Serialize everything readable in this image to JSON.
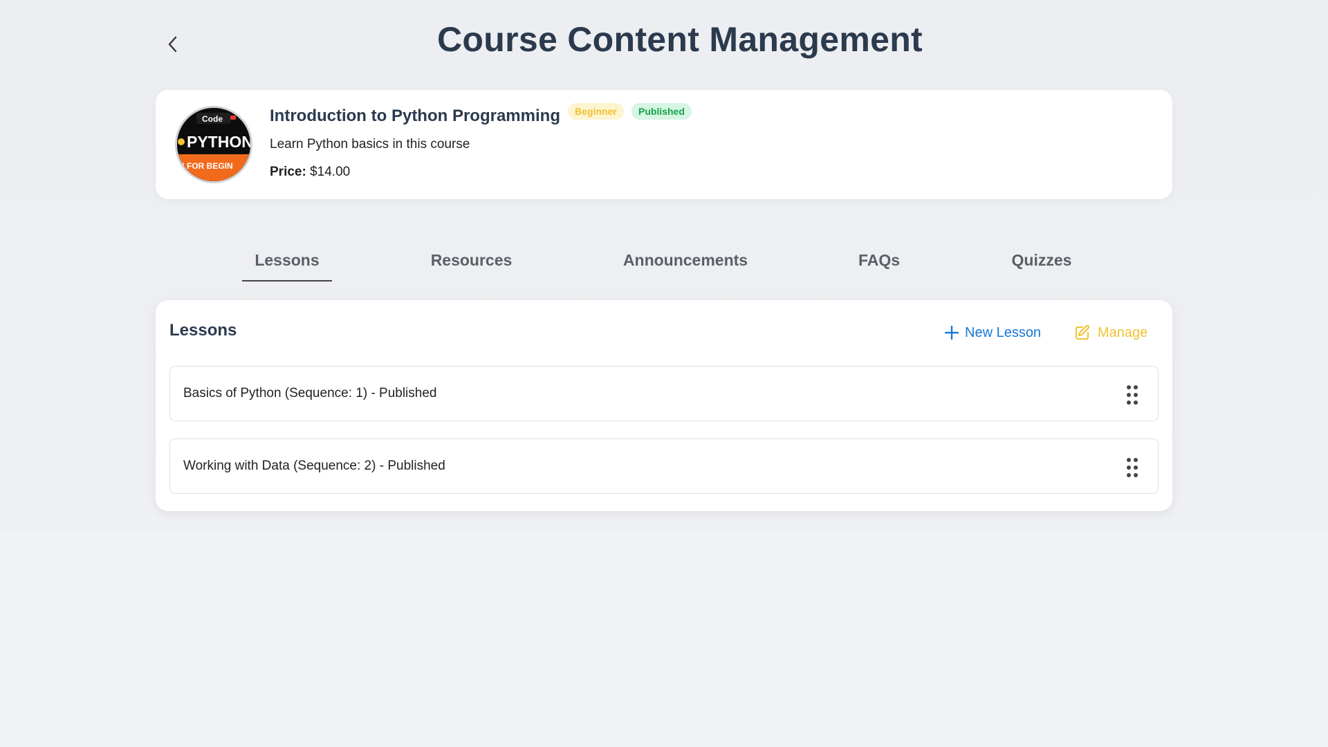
{
  "page": {
    "title": "Course Content Management",
    "back_icon": "chevron-left-icon"
  },
  "course": {
    "title": "Introduction to Python Programming",
    "level_badge": "Beginner",
    "status_badge": "Published",
    "description": "Learn Python basics in this course",
    "price_label": "Price:",
    "price_value": "$14.00",
    "thumbnail": {
      "brand_text": "Code",
      "headline_text": "PYTHON",
      "banner_text": "N FOR BEGIN"
    }
  },
  "tabs": [
    {
      "label": "Lessons",
      "active": true
    },
    {
      "label": "Resources",
      "active": false
    },
    {
      "label": "Announcements",
      "active": false
    },
    {
      "label": "FAQs",
      "active": false
    },
    {
      "label": "Quizzes",
      "active": false
    }
  ],
  "lessons_section": {
    "title": "Lessons",
    "new_button_label": "New Lesson",
    "manage_button_label": "Manage",
    "items": [
      {
        "label": "Basics of Python (Sequence: 1) - Published"
      },
      {
        "label": "Working with Data (Sequence: 2) - Published"
      }
    ]
  },
  "colors": {
    "title": "#2b3a4d",
    "new_lesson": "#1877d6",
    "manage": "#f1c232",
    "badge_beginner_bg": "#fdf4d0",
    "badge_published_bg": "#d7f5e3"
  }
}
